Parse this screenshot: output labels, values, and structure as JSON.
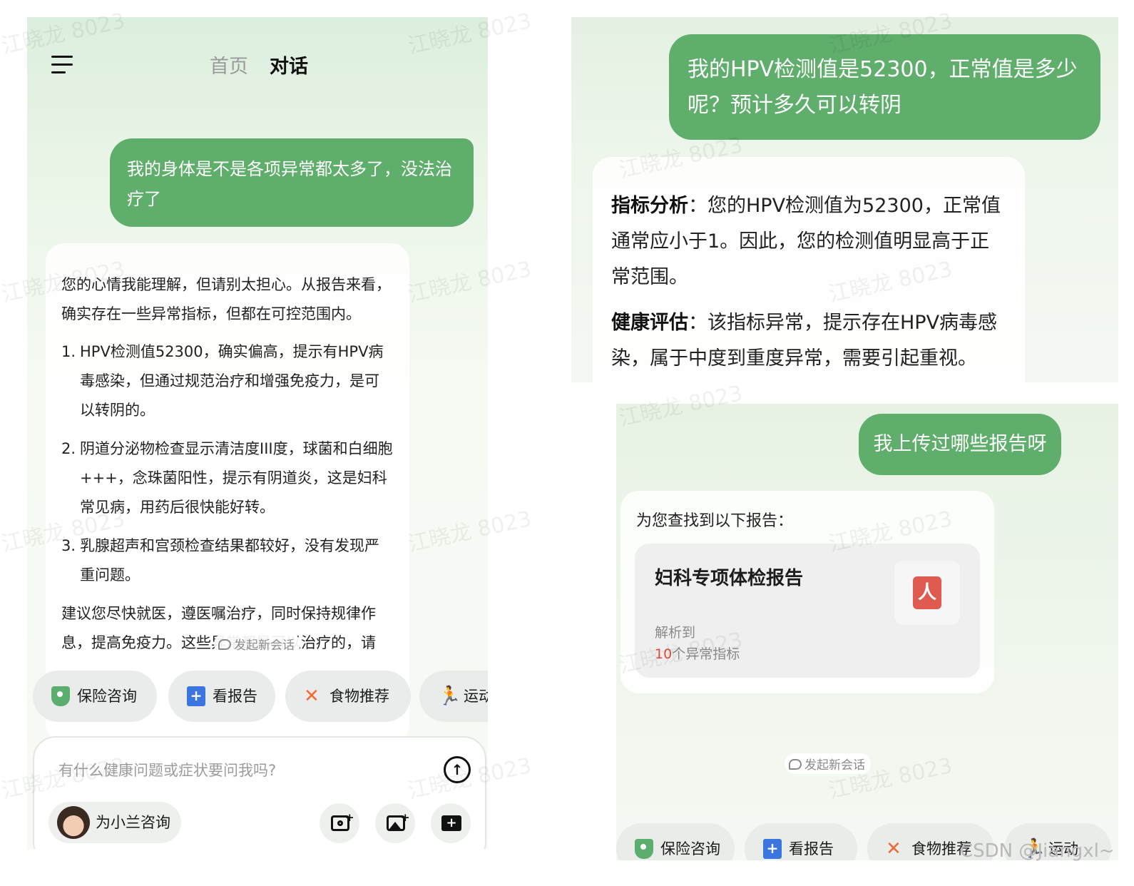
{
  "panel_a": {
    "tabs": [
      "首页",
      "对话"
    ],
    "user_message": "我的身体是不是各项异常都太多了，没法治疗了",
    "ai_reply": {
      "intro": "您的心情我能理解，但请别太担心。从报告来看，确实存在一些异常指标，但都在可控范围内。",
      "items": [
        {
          "num": "1.",
          "text": "HPV检测值52300，确实偏高，提示有HPV病毒感染，但通过规范治疗和增强免疫力，是可以转阴的。"
        },
        {
          "num": "2.",
          "text": "阴道分泌物检查显示清洁度III度，球菌和白细胞+++，念珠菌阳性，提示有阴道炎，这是妇科常见病，用药后很快能好转。"
        },
        {
          "num": "3.",
          "text": "乳腺超声和宫颈检查结果都较好，没有发现严重问题。"
        }
      ],
      "outro": "建议您尽快就医，遵医嘱治疗，同时保持规律作息，提高免疫力。这些异常都是可以治疗的，请"
    },
    "new_chat": "发起新会话",
    "quick_actions": [
      {
        "label": "保险咨询",
        "icon": "shield-icon"
      },
      {
        "label": "看报告",
        "icon": "report-icon"
      },
      {
        "label": "食物推荐",
        "icon": "fork-knife-icon"
      },
      {
        "label": "运动",
        "icon": "running-icon"
      }
    ],
    "input": {
      "placeholder": "有什么健康问题或症状要问我吗?",
      "consult_label": "为小兰咨询"
    }
  },
  "panel_b": {
    "user_message_1": "我的HPV检测值是52300，正常值是多少呢？预计多久可以转阴",
    "analysis": [
      {
        "label": "指标分析",
        "text": "：您的HPV检测值为52300，正常值通常应小于1。因此，您的检测值明显高于正常范围。"
      },
      {
        "label": "健康评估",
        "text": "：该指标异常，提示存在HPV病毒感染，属于中度到重度异常，需要引起重视。"
      }
    ],
    "user_message_2": "我上传过哪些报告呀",
    "found_text": "为您查找到以下报告：",
    "report": {
      "title": "妇科专项体检报告",
      "parsed_label": "解析到",
      "abnormal_count": "10",
      "abnormal_suffix": "个异常指标"
    },
    "new_chat": "发起新会话",
    "quick_actions": [
      {
        "label": "保险咨询",
        "icon": "shield-icon"
      },
      {
        "label": "看报告",
        "icon": "report-icon"
      },
      {
        "label": "食物推荐",
        "icon": "fork-knife-icon"
      },
      {
        "label": "运动",
        "icon": "running-icon"
      }
    ]
  },
  "watermark_text": "江晓龙 8023",
  "footer_credit": "CSDN @Jiangxl~",
  "colors": {
    "user_bubble": "#5fae6b",
    "accent_red": "#e24b3b",
    "pdf_red": "#df5a4f"
  }
}
